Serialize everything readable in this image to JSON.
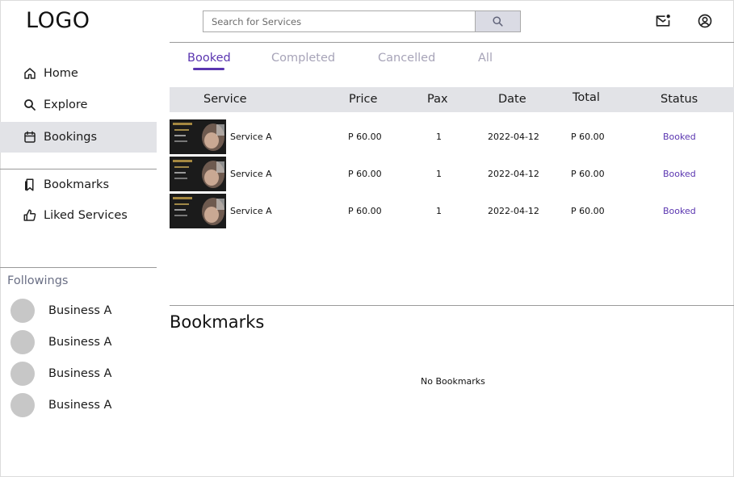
{
  "logo": "LOGO",
  "search": {
    "placeholder": "Search for Services"
  },
  "sidebar": {
    "items": [
      {
        "label": "Home",
        "icon": "home-icon",
        "active": false
      },
      {
        "label": "Explore",
        "icon": "search-icon",
        "active": false
      },
      {
        "label": "Bookings",
        "icon": "calendar-icon",
        "active": true
      },
      {
        "label": "Bookmarks",
        "icon": "bookmark-icon",
        "active": false
      },
      {
        "label": "Liked Services",
        "icon": "thumbs-up-icon",
        "active": false
      }
    ],
    "followings_title": "Followings",
    "followings": [
      {
        "name": "Business A"
      },
      {
        "name": "Business A"
      },
      {
        "name": "Business A"
      },
      {
        "name": "Business A"
      }
    ]
  },
  "header": {
    "icons": [
      "mail-notification-icon",
      "account-icon"
    ]
  },
  "tabs": [
    {
      "label": "Booked",
      "active": true
    },
    {
      "label": "Completed",
      "active": false
    },
    {
      "label": "Cancelled",
      "active": false
    },
    {
      "label": "All",
      "active": false
    }
  ],
  "table": {
    "columns": [
      "Service",
      "Price",
      "Pax",
      "Date",
      "Total",
      "Status"
    ],
    "rows": [
      {
        "service": "Service A",
        "price": "P 60.00",
        "pax": "1",
        "date": "2022-04-12",
        "total": "P 60.00",
        "status": "Booked"
      },
      {
        "service": "Service A",
        "price": "P 60.00",
        "pax": "1",
        "date": "2022-04-12",
        "total": "P 60.00",
        "status": "Booked"
      },
      {
        "service": "Service A",
        "price": "P 60.00",
        "pax": "1",
        "date": "2022-04-12",
        "total": "P 60.00",
        "status": "Booked"
      }
    ]
  },
  "bookmarks": {
    "title": "Bookmarks",
    "empty_text": "No Bookmarks"
  },
  "colors": {
    "accent": "#5a35b0",
    "active_bg": "#e2e3e7",
    "tab_inactive": "#a7a4b8",
    "followings_title": "#6a6f85"
  }
}
